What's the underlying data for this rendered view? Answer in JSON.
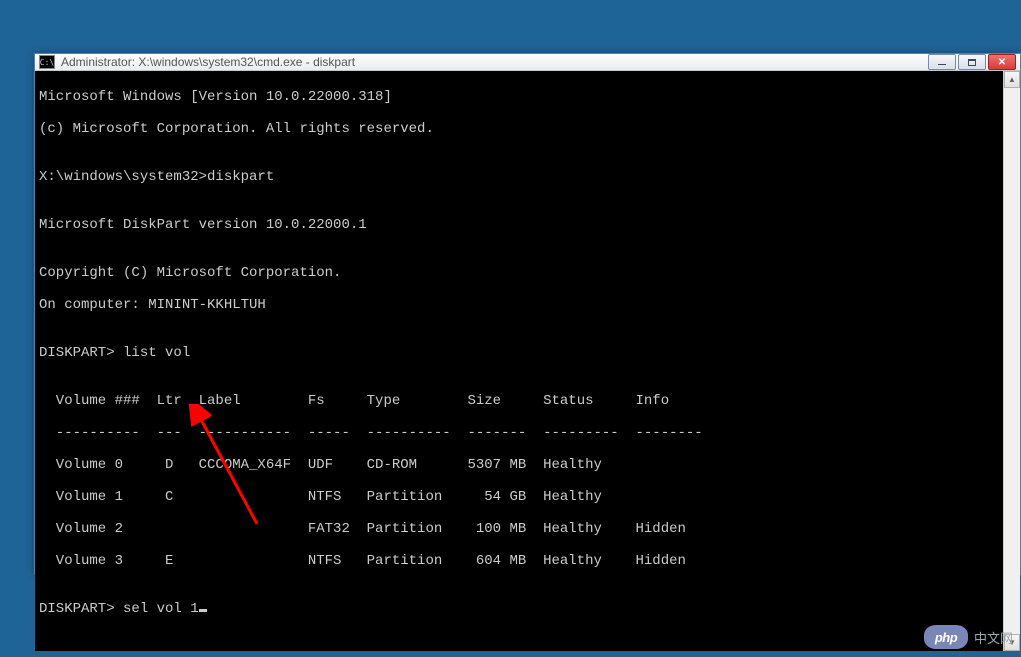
{
  "window": {
    "title": "Administrator: X:\\windows\\system32\\cmd.exe - diskpart"
  },
  "terminal": {
    "line0": "Microsoft Windows [Version 10.0.22000.318]",
    "line1": "(c) Microsoft Corporation. All rights reserved.",
    "blank": "",
    "line2": "X:\\windows\\system32>diskpart",
    "line3": "Microsoft DiskPart version 10.0.22000.1",
    "line4": "Copyright (C) Microsoft Corporation.",
    "line5": "On computer: MININT-KKHLTUH",
    "line6": "DISKPART> list vol",
    "header": "  Volume ###  Ltr  Label        Fs     Type        Size     Status     Info",
    "divider": "  ----------  ---  -----------  -----  ----------  -------  ---------  --------",
    "row0": "  Volume 0     D   CCCOMA_X64F  UDF    CD-ROM      5307 MB  Healthy",
    "row1": "  Volume 1     C                NTFS   Partition     54 GB  Healthy",
    "row2": "  Volume 2                      FAT32  Partition    100 MB  Healthy    Hidden",
    "row3": "  Volume 3     E                NTFS   Partition    604 MB  Healthy    Hidden",
    "prompt": "DISKPART> sel vol 1"
  },
  "watermark": {
    "logo": "php",
    "text": "中文网"
  }
}
